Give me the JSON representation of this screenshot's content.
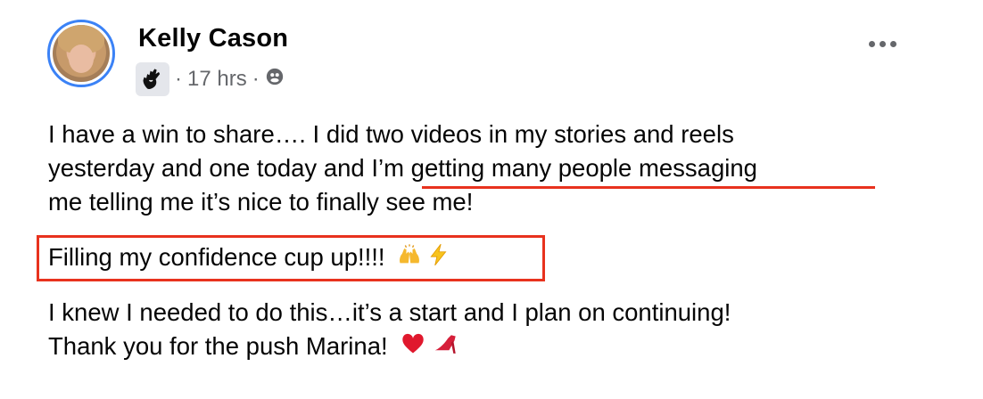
{
  "post": {
    "author_name": "Kelly Cason",
    "timestamp": "17 hrs",
    "separator": "·",
    "badge_icon": "waving-hand-icon",
    "audience_icon": "group-icon",
    "more_icon": "more-options-icon",
    "body": {
      "line1": "I have a win to share…. I did two videos in my stories and reels",
      "line2_start": "yesterday and one today and ",
      "line2_highlight": "I’m getting many people messaging",
      "line3": "me telling me it’s nice to finally see me!",
      "line4": "Filling my confidence cup up!!!!",
      "line5": "I knew I needed to do this…it’s a start and I plan on continuing!",
      "line6": "Thank you for the push Marina!"
    },
    "emojis": [
      "raising-hands-emoji",
      "lightning-emoji",
      "red-heart-emoji",
      "high-heel-emoji"
    ],
    "highlight_color": "#e8321e"
  }
}
